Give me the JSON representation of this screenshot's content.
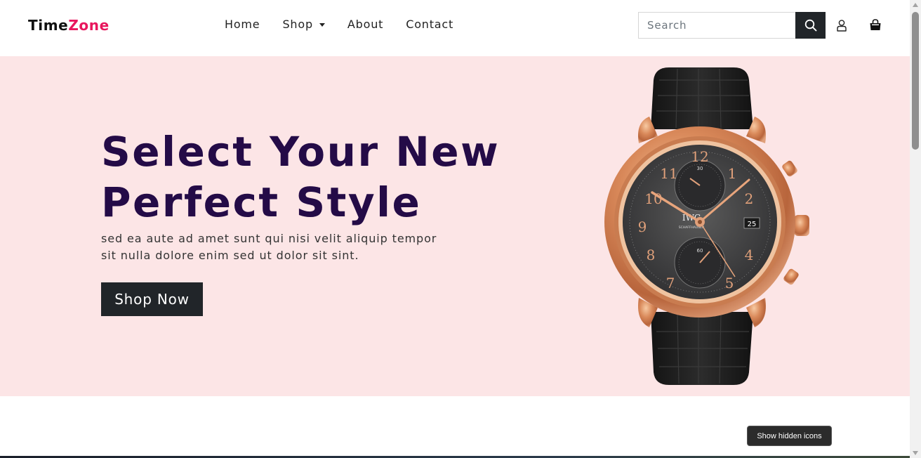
{
  "navbar": {
    "logo_part1": "Time",
    "logo_part2": "Zone",
    "links": [
      {
        "label": "Home"
      },
      {
        "label": "Shop",
        "dropdown": true
      },
      {
        "label": "About"
      },
      {
        "label": "Contact"
      }
    ],
    "search_placeholder": "Search",
    "search_icon": "search-icon",
    "user_icon": "user-icon",
    "bag_icon": "shopping-bag-icon"
  },
  "hero": {
    "title_line1": "Select Your New",
    "title_line2": "Perfect Style",
    "description": "sed ea aute ad amet sunt qui nisi velit aliquip tempor sit nulla dolore enim sed ut dolor sit sint.",
    "button_label": "Shop Now",
    "background": "#fce5e6",
    "title_color": "#240b47"
  },
  "watch": {
    "brand": "IWC",
    "sub_brand": "SCHAFFHAUSEN",
    "date": "25",
    "numerals": [
      "12",
      "1",
      "2",
      "4",
      "5",
      "7",
      "8",
      "9",
      "10",
      "11"
    ],
    "subdial_numerals": [
      "30",
      "60"
    ]
  },
  "tooltip": {
    "text": "Show hidden icons"
  },
  "colors": {
    "accent": "#e8175d",
    "dark": "#212529"
  }
}
